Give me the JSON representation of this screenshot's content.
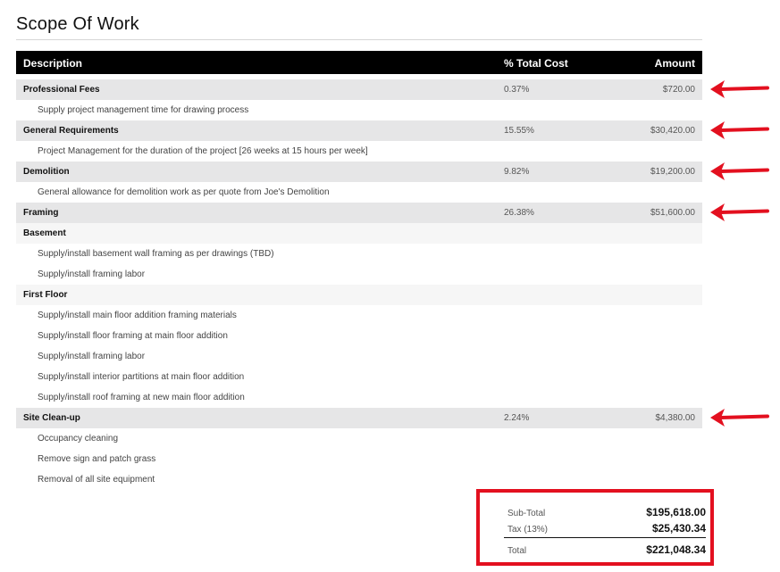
{
  "page": {
    "title": "Scope Of Work"
  },
  "table": {
    "headers": {
      "description": "Description",
      "pct": "% Total Cost",
      "amount": "Amount"
    },
    "rows": [
      {
        "type": "cat",
        "description": "Professional Fees",
        "pct": "0.37%",
        "amount": "$720.00",
        "highlighted": true
      },
      {
        "type": "item",
        "description": "Supply project management time for drawing process"
      },
      {
        "type": "cat",
        "description": "General Requirements",
        "pct": "15.55%",
        "amount": "$30,420.00",
        "highlighted": true
      },
      {
        "type": "item",
        "description": "Project Management for the duration of the project [26 weeks at 15 hours per week]"
      },
      {
        "type": "cat",
        "description": "Demolition",
        "pct": "9.82%",
        "amount": "$19,200.00",
        "highlighted": true
      },
      {
        "type": "item",
        "description": "General allowance for demolition work as per quote from Joe's Demolition"
      },
      {
        "type": "cat",
        "description": "Framing",
        "pct": "26.38%",
        "amount": "$51,600.00",
        "highlighted": true
      },
      {
        "type": "sub",
        "description": "Basement"
      },
      {
        "type": "item",
        "description": "Supply/install basement wall framing as per drawings (TBD)"
      },
      {
        "type": "item",
        "description": "Supply/install framing labor"
      },
      {
        "type": "sub",
        "description": "First Floor"
      },
      {
        "type": "item",
        "description": "Supply/install main floor addition framing materials"
      },
      {
        "type": "item",
        "description": "Supply/install floor framing at main floor addition"
      },
      {
        "type": "item",
        "description": "Supply/install framing labor"
      },
      {
        "type": "item",
        "description": "Supply/install interior partitions at main floor addition"
      },
      {
        "type": "item",
        "description": "Supply/install roof framing at new main floor addition"
      },
      {
        "type": "cat",
        "description": "Site Clean-up",
        "pct": "2.24%",
        "amount": "$4,380.00",
        "highlighted": true
      },
      {
        "type": "item",
        "description": "Occupancy cleaning"
      },
      {
        "type": "item",
        "description": "Remove sign and patch grass"
      },
      {
        "type": "item",
        "description": "Removal of all site equipment"
      }
    ]
  },
  "totals": {
    "subtotal_label": "Sub-Total",
    "subtotal_value": "$195,618.00",
    "tax_label": "Tax (13%)",
    "tax_value": "$25,430.34",
    "total_label": "Total",
    "total_value": "$221,048.34"
  },
  "annotations": {
    "color": "#e3101f",
    "arrow_icon": "left-arrow-icon"
  }
}
